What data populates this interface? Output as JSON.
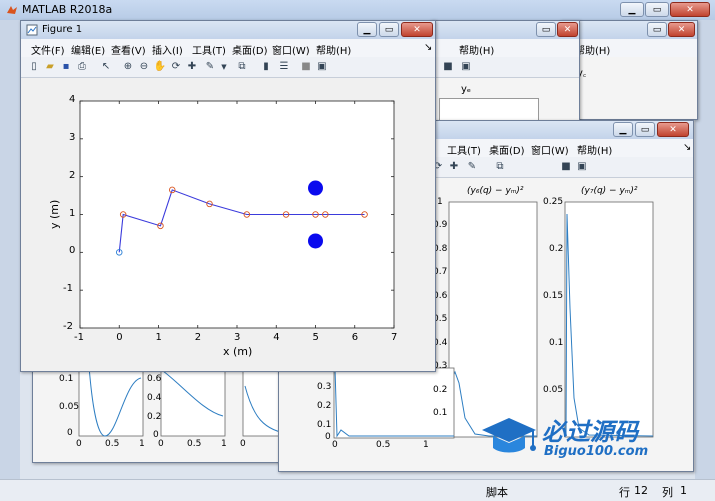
{
  "main_window": {
    "title": "MATLAB R2018a",
    "status": {
      "mode": "脚本",
      "row_label": "行",
      "row_value": "12",
      "col_label": "列",
      "col_value": "1"
    }
  },
  "background_fig_top": {
    "menu_help": "帮助(H)",
    "plot_title": "yₑ"
  },
  "background_fig_right": {
    "menu_help": "帮助(H)",
    "plot_title": "y꜀"
  },
  "background_fig_middle": {
    "menus": [
      "工具(T)",
      "桌面(D)",
      "窗口(W)",
      "帮助(H)"
    ],
    "plot1_title": "(y₆(q) − yₘ)²",
    "plot1_yticks": [
      "1",
      "0.9",
      "0.8",
      "0.7",
      "0.6",
      "0.5",
      "0.4",
      "0.3",
      "0.2",
      "0.1"
    ],
    "plot2_title": "(y₇(q) − yₘ)²",
    "plot2_yticks": [
      "0.25",
      "0.2",
      "0.15",
      "0.1",
      "0.05"
    ],
    "bottom_yticks": [
      "0.3",
      "0.2",
      "0.1",
      "0"
    ],
    "bottom_xticks": [
      "0",
      "0.5",
      "1"
    ]
  },
  "background_fig_bottom_left": {
    "yticks_a": [
      "0.1",
      "0.05",
      "0"
    ],
    "yticks_b": [
      "0.6",
      "0.4",
      "0.2",
      "0"
    ],
    "xticks_a": [
      "0",
      "0.5",
      "1"
    ],
    "xticks_b": [
      "0",
      "0.5",
      "1"
    ],
    "xtick_c": "0"
  },
  "watermark": {
    "brand": "必过源码",
    "url": "Biguo100.com"
  },
  "figure1": {
    "title": "Figure 1",
    "menus": [
      "文件(F)",
      "编辑(E)",
      "查看(V)",
      "插入(I)",
      "工具(T)",
      "桌面(D)",
      "窗口(W)",
      "帮助(H)"
    ]
  },
  "chart_data": {
    "type": "line",
    "title": "",
    "xlabel": "x (m)",
    "ylabel": "y (m)",
    "xlim": [
      -1,
      7
    ],
    "ylim": [
      -2,
      4
    ],
    "xticks": [
      -1,
      0,
      1,
      2,
      3,
      4,
      5,
      6,
      7
    ],
    "yticks": [
      -2,
      -1,
      0,
      1,
      2,
      3,
      4
    ],
    "grid": false,
    "series": [
      {
        "x": [
          0,
          0.1,
          1.05,
          1.35,
          2.3,
          3.25,
          4.25,
          5.0,
          5.25,
          6.25
        ],
        "y": [
          0,
          1.0,
          0.7,
          1.65,
          1.28,
          1.0,
          1.0,
          1.0,
          1.0,
          1.0
        ],
        "color": "#3b3bdc",
        "marker_color": "#d9541f"
      }
    ],
    "start_marker_color": "#2a7fd4",
    "obstacles": [
      {
        "x": 5.0,
        "y": 1.7,
        "color": "#0a0aee"
      },
      {
        "x": 5.0,
        "y": 0.3,
        "color": "#0a0aee"
      }
    ]
  },
  "colors": {
    "accent": "#2e76c8",
    "plot_line": "#2e7ec2"
  }
}
